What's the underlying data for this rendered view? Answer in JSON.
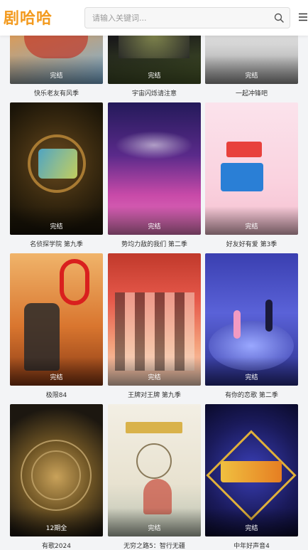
{
  "header": {
    "logo": "剧哈哈",
    "search_placeholder": "请输入关键词...",
    "search_icon": "search-icon",
    "menu_icon": "menu-icon"
  },
  "shows": [
    {
      "title": "快乐老友有风季",
      "status": "完结"
    },
    {
      "title": "宇宙闪烁请注意",
      "status": "完结"
    },
    {
      "title": "一起冲锋吧",
      "status": "完结"
    },
    {
      "title": "名侦探学院 第九季",
      "status": "完结"
    },
    {
      "title": "势均力敌的我们 第二季",
      "status": "完结"
    },
    {
      "title": "好友好有爱 第3季",
      "status": "完结"
    },
    {
      "title": "极限84",
      "status": "完结"
    },
    {
      "title": "王牌对王牌 第九季",
      "status": "完结"
    },
    {
      "title": "有你的恋歌 第二季",
      "status": "完结"
    },
    {
      "title": "有歌2024",
      "status": "12期全"
    },
    {
      "title": "无穷之路5：智行无疆",
      "status": "完结"
    },
    {
      "title": "中年好声音4",
      "status": "完结"
    }
  ]
}
